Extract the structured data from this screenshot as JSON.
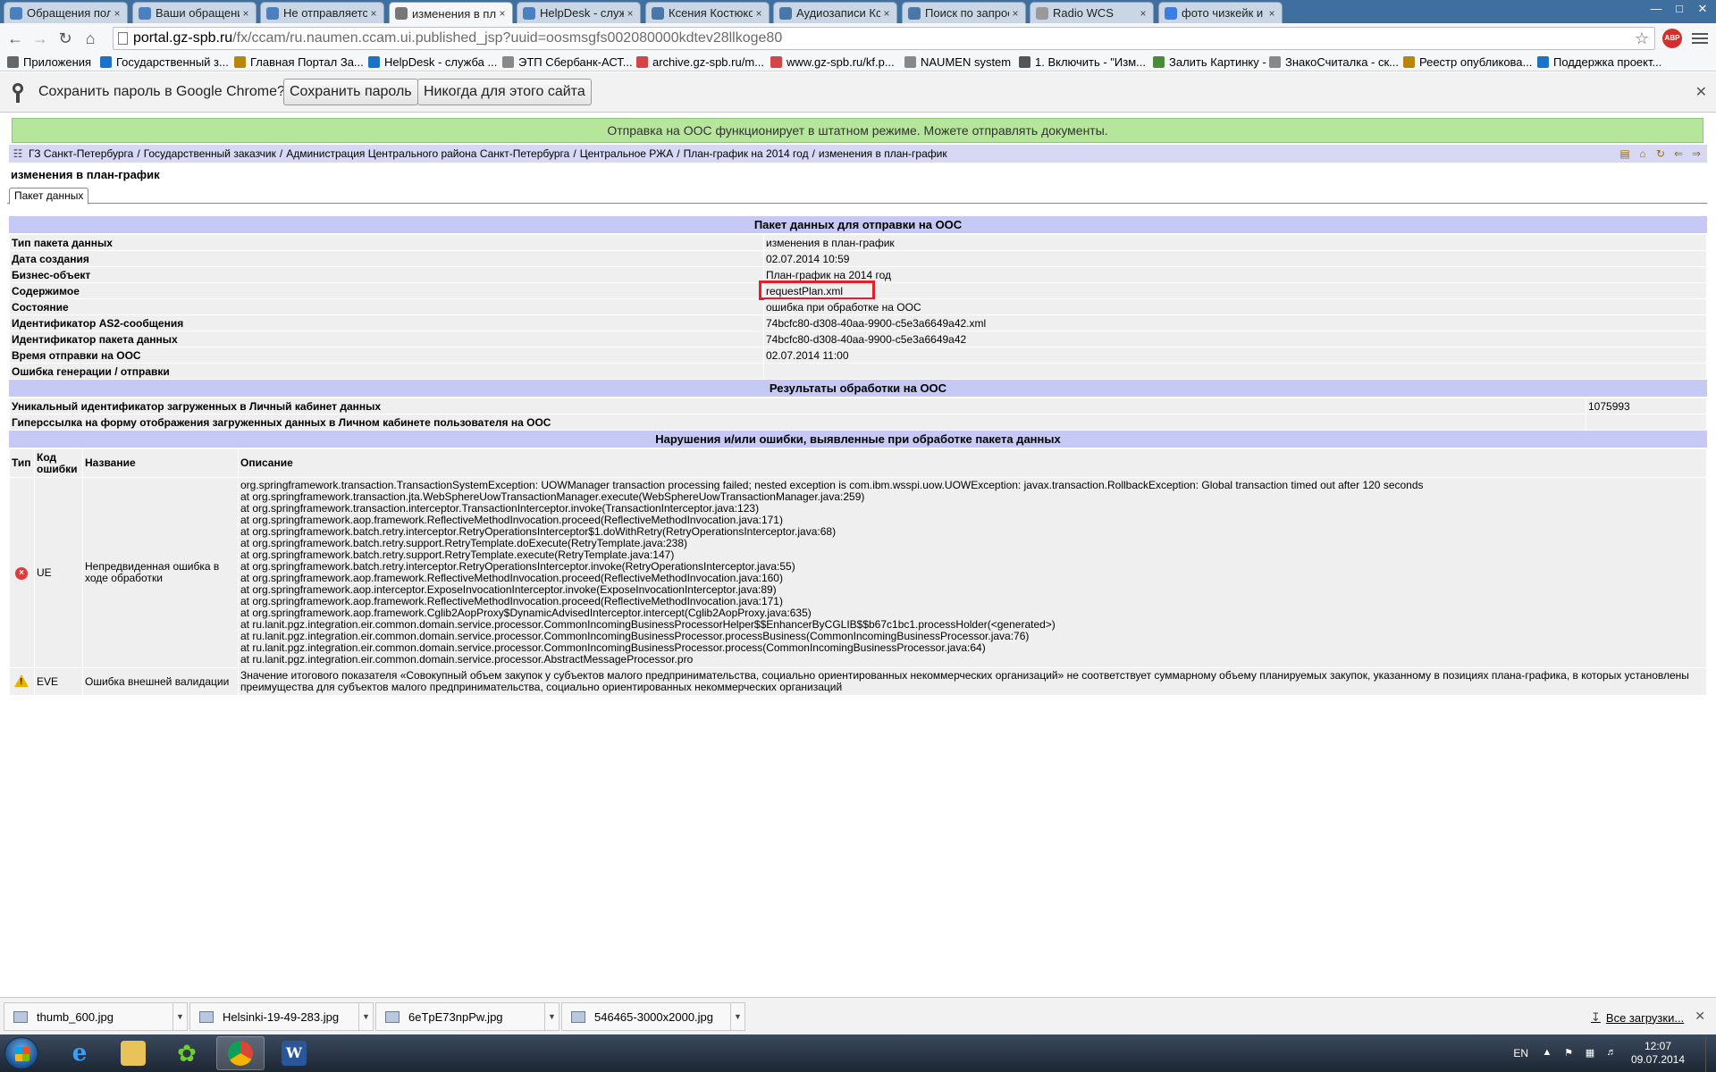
{
  "browser": {
    "tabs": [
      {
        "label": "Обращения пользова",
        "color": "#4a7fc0"
      },
      {
        "label": "Ваши обращения | Не",
        "color": "#4a7fc0"
      },
      {
        "label": "Не отправляется план",
        "color": "#4a7fc0"
      },
      {
        "label": "изменения в план-гра",
        "color": "#777777"
      },
      {
        "label": "HelpDesk - служба тех",
        "color": "#4a7fc0"
      },
      {
        "label": "Ксения Костюкова",
        "color": "#4a76a8"
      },
      {
        "label": "Аудиозаписи Ксении К",
        "color": "#4a76a8"
      },
      {
        "label": "Поиск по запросу Sla",
        "color": "#4a76a8"
      },
      {
        "label": "Radio WCS",
        "color": "#999999"
      },
      {
        "label": "фото чизкейк и капуч",
        "color": "#3b7de0"
      }
    ],
    "url_host": "portal.gz-spb.ru",
    "url_path": "/fx/ccam/ru.naumen.ccam.ui.published_jsp?uuid=oosmsgfs002080000kdtev28llkoge80",
    "abp_label": "ABP",
    "bookmarks": [
      {
        "label": "Приложения",
        "color": "#666666"
      },
      {
        "label": "Государственный з...",
        "color": "#1a73c9"
      },
      {
        "label": "Главная Портал За...",
        "color": "#b8860b"
      },
      {
        "label": "HelpDesk - служба ...",
        "color": "#1a73c9"
      },
      {
        "label": "ЭТП Сбербанк-АСТ...",
        "color": "#888888"
      },
      {
        "label": "archive.gz-spb.ru/m...",
        "color": "#d64545"
      },
      {
        "label": "www.gz-spb.ru/kf.p...",
        "color": "#d64545"
      },
      {
        "label": "NAUMEN system",
        "color": "#888888"
      },
      {
        "label": "1. Включить - \"Изм...",
        "color": "#555555"
      },
      {
        "label": "Залить Картинку - ...",
        "color": "#4a8a3a"
      },
      {
        "label": "ЗнакоСчиталка - ск...",
        "color": "#888888"
      },
      {
        "label": "Реестр опубликова...",
        "color": "#b8860b"
      },
      {
        "label": "Поддержка проект...",
        "color": "#1a73c9"
      }
    ]
  },
  "password_bar": {
    "message": "Сохранить пароль в Google Chrome?",
    "save_label": "Сохранить пароль",
    "never_label": "Никогда для этого сайта"
  },
  "page": {
    "status_banner": "Отправка на ООС функционирует в штатном режиме. Можете отправлять документы.",
    "breadcrumbs": [
      "ГЗ Санкт-Петербурга",
      "Государственный заказчик",
      "Администрация Центрального района Санкт-Петербурга",
      "Центральное РЖА",
      "План-график на 2014 год",
      "изменения в план-график"
    ],
    "title": "изменения в план-график",
    "tab_label": "Пакет данных",
    "section_package": {
      "header": "Пакет данных для отправки на ООС",
      "rows": [
        {
          "k": "Тип пакета данных",
          "v": "изменения в план-график"
        },
        {
          "k": "Дата создания",
          "v": "02.07.2014 10:59"
        },
        {
          "k": "Бизнес-объект",
          "v": "План-график на 2014 год"
        },
        {
          "k": "Содержимое",
          "v": "requestPlan.xml"
        },
        {
          "k": "Состояние",
          "v": "ошибка при обработке на ООС"
        },
        {
          "k": "Идентификатор AS2-сообщения",
          "v": "74bcfc80-d308-40aa-9900-c5e3a6649a42.xml"
        },
        {
          "k": "Идентификатор пакета данных",
          "v": "74bcfc80-d308-40aa-9900-c5e3a6649a42"
        },
        {
          "k": "Время отправки на ООС",
          "v": "02.07.2014 11:00"
        },
        {
          "k": "Ошибка генерации / отправки",
          "v": ""
        }
      ]
    },
    "section_results": {
      "header": "Результаты обработки на ООС",
      "rows": [
        {
          "k": "Уникальный идентификатор загруженных в Личный кабинет данных",
          "v": "1075993"
        },
        {
          "k": "Гиперссылка на форму отображения загруженных данных в Личном кабинете пользователя на ООС",
          "v": ""
        }
      ]
    },
    "section_errors": {
      "header": "Нарушения и/или ошибки, выявленные при обработке пакета данных",
      "columns": [
        "Тип",
        "Код ошибки",
        "Название",
        "Описание"
      ],
      "rows": [
        {
          "icon": "error",
          "code": "UE",
          "name": "Непредвиденная ошибка в ходе обработки",
          "desc": "org.springframework.transaction.TransactionSystemException: UOWManager transaction processing failed; nested exception is com.ibm.wsspi.uow.UOWException: javax.transaction.RollbackException: Global transaction timed out after 120 seconds\nat org.springframework.transaction.jta.WebSphereUowTransactionManager.execute(WebSphereUowTransactionManager.java:259)\nat org.springframework.transaction.interceptor.TransactionInterceptor.invoke(TransactionInterceptor.java:123)\nat org.springframework.aop.framework.ReflectiveMethodInvocation.proceed(ReflectiveMethodInvocation.java:171)\nat org.springframework.batch.retry.interceptor.RetryOperationsInterceptor$1.doWithRetry(RetryOperationsInterceptor.java:68)\nat org.springframework.batch.retry.support.RetryTemplate.doExecute(RetryTemplate.java:238)\nat org.springframework.batch.retry.support.RetryTemplate.execute(RetryTemplate.java:147)\nat org.springframework.batch.retry.interceptor.RetryOperationsInterceptor.invoke(RetryOperationsInterceptor.java:55)\nat org.springframework.aop.framework.ReflectiveMethodInvocation.proceed(ReflectiveMethodInvocation.java:160)\nat org.springframework.aop.interceptor.ExposeInvocationInterceptor.invoke(ExposeInvocationInterceptor.java:89)\nat org.springframework.aop.framework.ReflectiveMethodInvocation.proceed(ReflectiveMethodInvocation.java:171)\nat org.springframework.aop.framework.Cglib2AopProxy$DynamicAdvisedInterceptor.intercept(Cglib2AopProxy.java:635)\nat ru.lanit.pgz.integration.eir.common.domain.service.processor.CommonIncomingBusinessProcessorHelper$$EnhancerByCGLIB$$b67c1bc1.processHolder(<generated>)\nat ru.lanit.pgz.integration.eir.common.domain.service.processor.CommonIncomingBusinessProcessor.processBusiness(CommonIncomingBusinessProcessor.java:76)\nat ru.lanit.pgz.integration.eir.common.domain.service.processor.CommonIncomingBusinessProcessor.process(CommonIncomingBusinessProcessor.java:64)\nat ru.lanit.pgz.integration.eir.common.domain.service.processor.AbstractMessageProcessor.pro"
        },
        {
          "icon": "warning",
          "code": "EVE",
          "name": "Ошибка внешней валидации",
          "desc": "Значение итогового показателя «Совокупный объем закупок у субъектов малого предпринимательства, социально ориентированных некоммерческих организаций» не соответствует суммарному объему планируемых закупок, указанному в позициях плана-графика, в которых установлены преимущества для субъектов малого предпринимательства, социально ориентированных некоммерческих организаций"
        }
      ]
    }
  },
  "downloads": {
    "items": [
      "thumb_600.jpg",
      "Helsinki-19-49-283.jpg",
      "6eTpE73npPw.jpg",
      "546465-3000x2000.jpg"
    ],
    "all_label": "Все загрузки..."
  },
  "taskbar": {
    "lang": "EN",
    "time": "12:07",
    "date": "09.07.2014"
  }
}
